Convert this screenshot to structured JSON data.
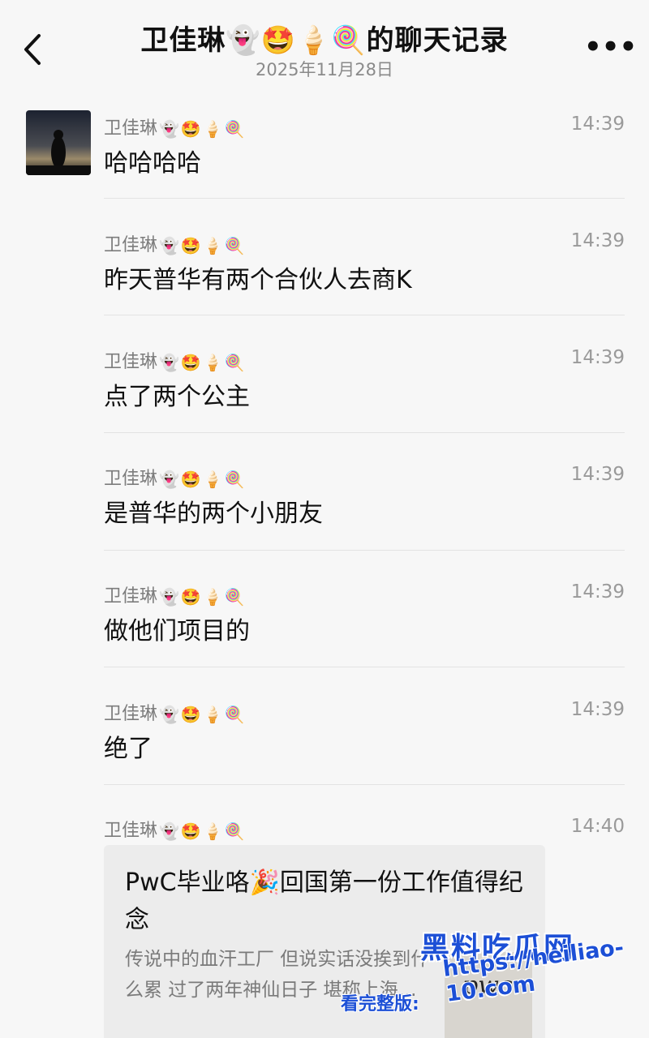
{
  "header": {
    "title": "卫佳琳👻🤩🍦🍭的聊天记录",
    "date": "2025年11月28日",
    "more_label": "•••"
  },
  "sender": {
    "name": "卫佳琳",
    "emojis": [
      "👻",
      "🤩",
      "🍦",
      "🍭"
    ]
  },
  "messages": [
    {
      "time": "14:39",
      "text": "哈哈哈哈"
    },
    {
      "time": "14:39",
      "text": "昨天普华有两个合伙人去商K"
    },
    {
      "time": "14:39",
      "text": "点了两个公主"
    },
    {
      "time": "14:39",
      "text": "是普华的两个小朋友"
    },
    {
      "time": "14:39",
      "text": "做他们项目的"
    },
    {
      "time": "14:39",
      "text": "绝了"
    },
    {
      "time": "14:40",
      "text": ""
    }
  ],
  "card": {
    "title": "PwC毕业咯🎉回国第一份工作值得纪念",
    "desc": "传说中的血汗工厂 但说实话没挨到什么累 过了两年神仙日子 堪称上海…",
    "thumb_text": "pwc"
  },
  "watermark": {
    "main": "黑料吃瓜网",
    "url_label": "看完整版:",
    "url": "https://heiliao-10.com"
  }
}
